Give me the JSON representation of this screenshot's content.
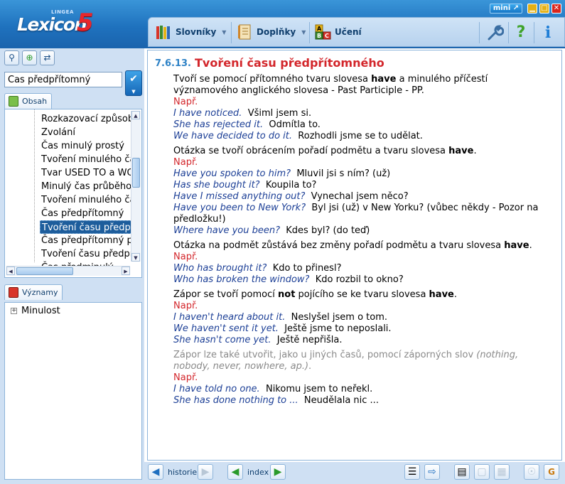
{
  "app": {
    "logo_small": "LINGEA",
    "logo_word": "Lexicon",
    "logo_number": "5",
    "mini_label": "mini",
    "window_buttons": {
      "minimize": "▁",
      "maximize": "□",
      "close": "✕"
    }
  },
  "menu": {
    "items": [
      {
        "label": "Slovníky",
        "icon": "books-icon"
      },
      {
        "label": "Doplňky",
        "icon": "notebook-icon"
      },
      {
        "label": "Učení",
        "icon": "abc-blocks-icon"
      }
    ],
    "tools": {
      "settings": "wrench-icon",
      "help": "?",
      "info": "i"
    }
  },
  "search": {
    "value": "Čas předpřítomný",
    "go_icon": "✔"
  },
  "tabs": {
    "contents": "Obsah",
    "meanings": "Významy"
  },
  "tree": {
    "items": [
      "Rozkazovací způsob",
      "Zvolání",
      "Čas minulý prostý",
      "Tvoření minulého času",
      "Tvar USED TO a WOULD",
      "Minulý čas průběhový",
      "Tvoření minulého času průběhového",
      "Čas předpřítomný",
      "Tvoření času předpřítomného",
      "Čas předpřítomný průběhový",
      "Tvoření času předpřítomného průběhového",
      "Čas předminulý"
    ],
    "selected_index": 8
  },
  "meanings": {
    "item": "Minulost",
    "expander": "+"
  },
  "article": {
    "number": "7.6.13.",
    "title": "Tvoření času předpřítomného",
    "p1_a": "Tvoří se pomocí přítomného tvaru slovesa ",
    "p1_b": "have",
    "p1_c": " a minulého příčestí",
    "p1_d": "významového anglického slovesa - Past Participle - PP.",
    "napr": "Např.",
    "ex1": [
      {
        "en": "I have noticed.",
        "cz": "Všiml jsem si."
      },
      {
        "en": "She has rejected it.",
        "cz": "Odmítla to."
      },
      {
        "en": "We have decided to do it.",
        "cz": "Rozhodli jsme se to udělat."
      }
    ],
    "p2_a": "Otázka se tvoří obrácením pořadí podmětu a tvaru slovesa ",
    "p2_b": "have",
    "p2_c": ".",
    "ex2": [
      {
        "en": "Have you spoken to him?",
        "cz": "Mluvil jsi s ním? (už)"
      },
      {
        "en": "Has she bought it?",
        "cz": "Koupila to?"
      },
      {
        "en": "Have I missed anything out?",
        "cz": "Vynechal jsem něco?"
      },
      {
        "en": "Have you been to New York?",
        "cz": "Byl jsi (už) v New Yorku? (vůbec někdy - Pozor na"
      },
      {
        "en": "",
        "cz": "předložku!)"
      },
      {
        "en": "Where have you been?",
        "cz": "Kdes byl? (do teď)"
      }
    ],
    "p3_a": "Otázka na podmět zůstává bez změny pořadí podmětu a tvaru slovesa ",
    "p3_b": "have",
    "p3_c": ".",
    "ex3": [
      {
        "en": "Who has brought it?",
        "cz": "Kdo to přinesl?"
      },
      {
        "en": "Who has broken the window?",
        "cz": "Kdo rozbil to okno?"
      }
    ],
    "p4_a": "Zápor se tvoří pomocí ",
    "p4_b": "not",
    "p4_c": " pojícího se ke tvaru slovesa ",
    "p4_d": "have",
    "p4_e": ".",
    "ex4": [
      {
        "en": "I haven't heard about it.",
        "cz": "Neslyšel jsem o tom."
      },
      {
        "en": "We haven't sent it yet.",
        "cz": "Ještě jsme to neposlali."
      },
      {
        "en": "She hasn't come yet.",
        "cz": "Ještě nepřišla."
      }
    ],
    "p5_a": "Zápor lze také utvořit, jako u jiných časů, pomocí záporných slov ",
    "p5_b": "(nothing,",
    "p5_c": "nobody, never, nowhere, ap.)",
    "p5_d": ".",
    "ex5": [
      {
        "en": "I have told no one.",
        "cz": "Nikomu jsem to neřekl."
      },
      {
        "en": "She has done nothing to ...",
        "cz": "Neudělala nic ..."
      }
    ]
  },
  "bottom": {
    "history_label": "historie",
    "index_label": "index"
  },
  "colors": {
    "header_blue": "#1f72be",
    "title_red": "#d3262b",
    "english_blue": "#1c3f96",
    "section_blue": "#2e82c6"
  }
}
